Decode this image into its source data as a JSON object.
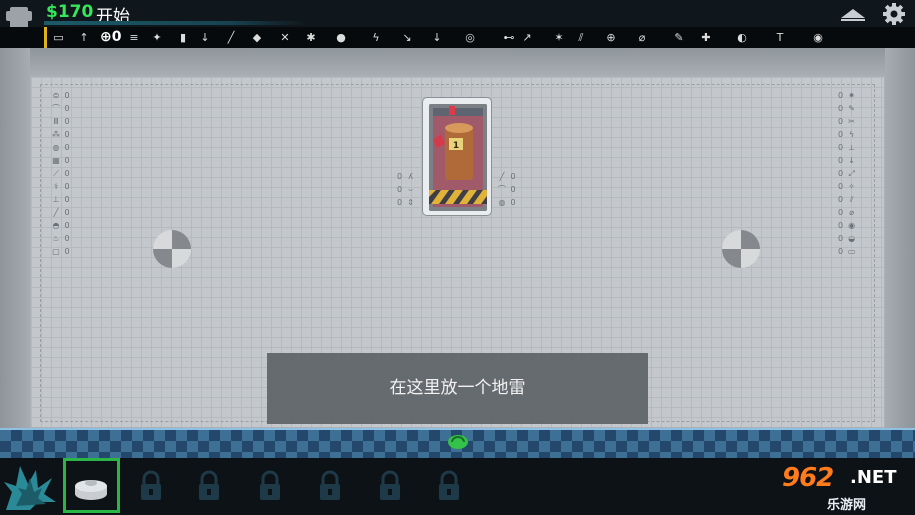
{
  "header": {
    "money": "$170",
    "start_label": "开始",
    "counter": "0"
  },
  "toolbar": {
    "items": [
      "↑",
      "≡",
      "⊕",
      "✦",
      "▮",
      "↓",
      "╱",
      "◆",
      "✕",
      "✱",
      "●",
      "ϟ",
      "↘",
      "↓",
      "◎",
      "⊷",
      "↗",
      "✶",
      "⫽",
      "⌀",
      "✎",
      "✚",
      "◐",
      "T",
      "◉"
    ]
  },
  "left_stats": [
    "0",
    "0",
    "0",
    "0",
    "0",
    "0",
    "0",
    "0",
    "0",
    "0",
    "0",
    "0",
    "0"
  ],
  "right_stats": [
    "0",
    "0",
    "0",
    "0",
    "0",
    "0",
    "0",
    "0",
    "0",
    "0",
    "0",
    "0",
    "0"
  ],
  "card": {
    "number": "1",
    "left_stats": [
      "0",
      "0",
      "0"
    ],
    "right_stats": [
      "0",
      "0",
      "0"
    ]
  },
  "tooltip": "在这里放一个地雷",
  "watermark": {
    "number": "962",
    "net": ".NET",
    "site": "乐游网"
  },
  "colors": {
    "money": "#35e65a",
    "selected_slot": "#2cb547",
    "floor": "#3e6f95",
    "watermark": "#ff7b1c"
  }
}
